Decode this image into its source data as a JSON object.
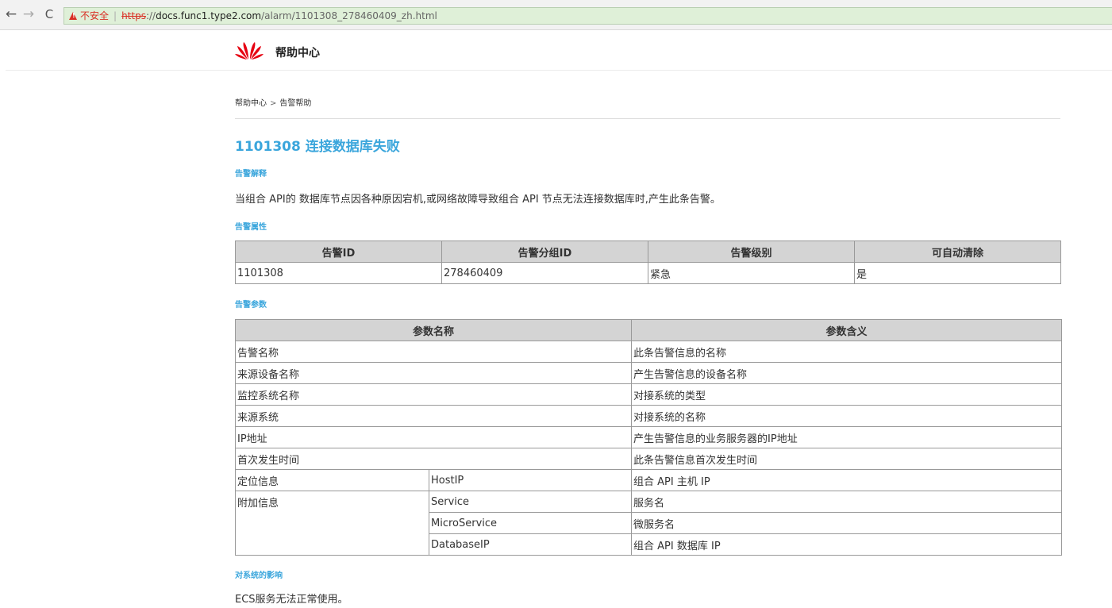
{
  "browser": {
    "back_icon": "←",
    "forward_icon": "→",
    "reload_icon": "C",
    "security_label": "不安全",
    "separator": "|",
    "url_scheme": "https",
    "url_sep": "://",
    "url_host": "docs.func1.type2.com",
    "url_path": "/alarm/1101308_278460409_zh.html"
  },
  "header": {
    "site_title": "帮助中心",
    "logo_color": "#e60012"
  },
  "breadcrumb": {
    "home": "帮助中心",
    "arrow": ">",
    "current": "告警帮助"
  },
  "page": {
    "title": "1101308 连接数据库失败",
    "accent": "#3ba6dc"
  },
  "sections": {
    "explain_title": "告警解释",
    "explain_text": "当组合 API的 数据库节点因各种原因宕机,或网络故障导致组合 API 节点无法连接数据库时,产生此条告警。",
    "attr_title": "告警属性",
    "params_title": "告警参数",
    "impact_title": "对系统的影响",
    "impact_text": "ECS服务无法正常使用。"
  },
  "attr_table": {
    "headers": [
      "告警ID",
      "告警分组ID",
      "告警级别",
      "可自动清除"
    ],
    "row": [
      "1101308",
      "278460409",
      "紧急",
      "是"
    ]
  },
  "params_table": {
    "headers": [
      "参数名称",
      "参数含义"
    ],
    "simple_rows": [
      {
        "name": "告警名称",
        "meaning": "此条告警信息的名称"
      },
      {
        "name": "来源设备名称",
        "meaning": "产生告警信息的设备名称"
      },
      {
        "name": "监控系统名称",
        "meaning": "对接系统的类型"
      },
      {
        "name": "来源系统",
        "meaning": "对接系统的名称"
      },
      {
        "name": "IP地址",
        "meaning": "产生告警信息的业务服务器的IP地址"
      },
      {
        "name": "首次发生时间",
        "meaning": "此条告警信息首次发生时间"
      }
    ],
    "location": {
      "name": "定位信息",
      "sub": "HostIP",
      "meaning": "组合 API 主机 IP"
    },
    "extra": {
      "name": "附加信息",
      "items": [
        {
          "sub": "Service",
          "meaning": "服务名"
        },
        {
          "sub": "MicroService",
          "meaning": "微服务名"
        },
        {
          "sub": "DatabaseIP",
          "meaning": "组合 API 数据库 IP"
        }
      ]
    }
  }
}
